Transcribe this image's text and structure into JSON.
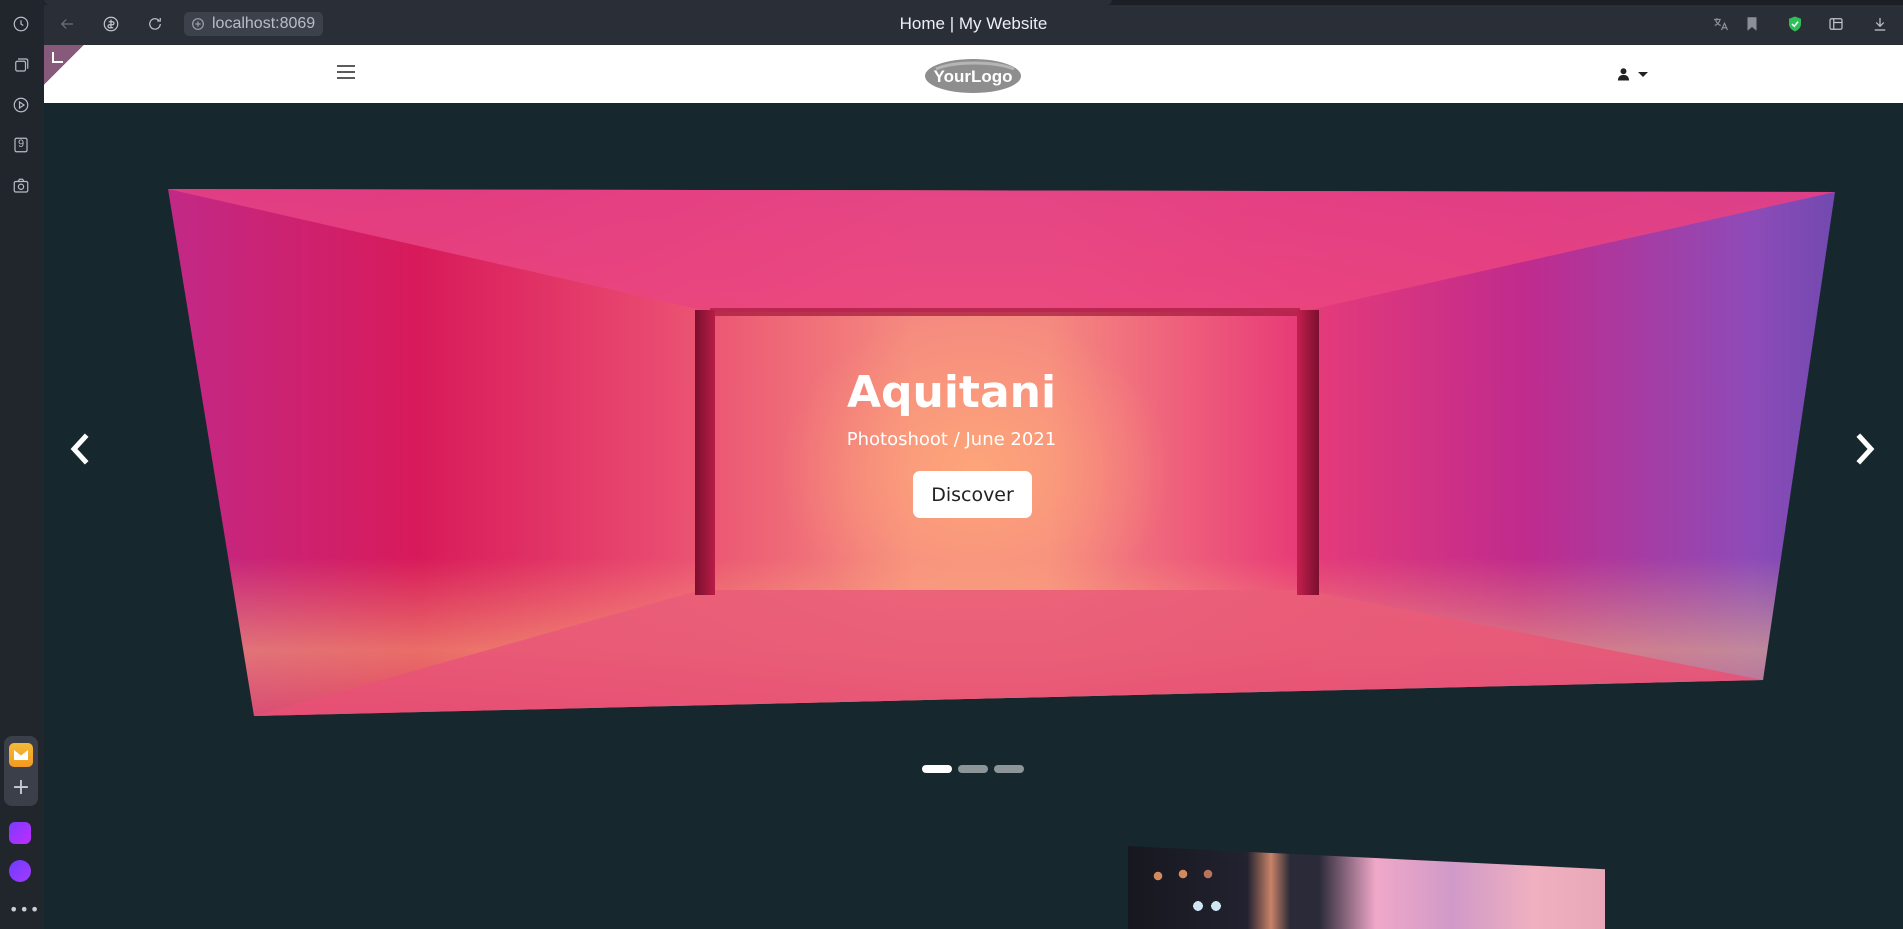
{
  "browser": {
    "url": "localhost:8069",
    "page_title": "Home | My Website",
    "rail_icons": [
      "history-icon",
      "tabs-icon",
      "play-icon",
      "counter-9-icon",
      "camera-icon"
    ],
    "rail_counter_label": "9"
  },
  "header": {
    "logo_text": "YourLogo"
  },
  "carousel": {
    "title": "Aquitani",
    "subtitle": "Photoshoot / June 2021",
    "button_label": "Discover",
    "slide_count": 3,
    "active_index": 0
  },
  "colors": {
    "page_bg": "#16282e",
    "header_bg": "#ffffff",
    "odoo_purple": "#875a7b",
    "indicator_active": "#ffffff",
    "indicator_inactive": "#8c9698"
  }
}
